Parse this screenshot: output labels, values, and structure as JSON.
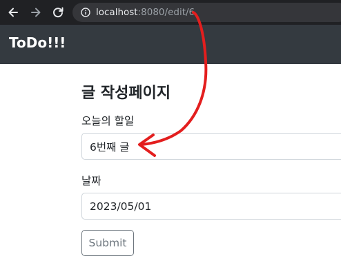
{
  "browser": {
    "url_host": "localhost",
    "url_rest": ":8080/edit/6",
    "icons": [
      "back-arrow-icon",
      "forward-arrow-icon",
      "reload-icon",
      "info-icon"
    ]
  },
  "navbar": {
    "brand": "ToDo!!!",
    "background": "#343a40"
  },
  "form": {
    "title": "글 작성페이지",
    "todo_label": "오늘의 할일",
    "todo_value": "6번째 글",
    "date_label": "날짜",
    "date_value": "2023/05/01",
    "submit_label": "Submit"
  },
  "annotation": {
    "color": "#e31e1e"
  }
}
